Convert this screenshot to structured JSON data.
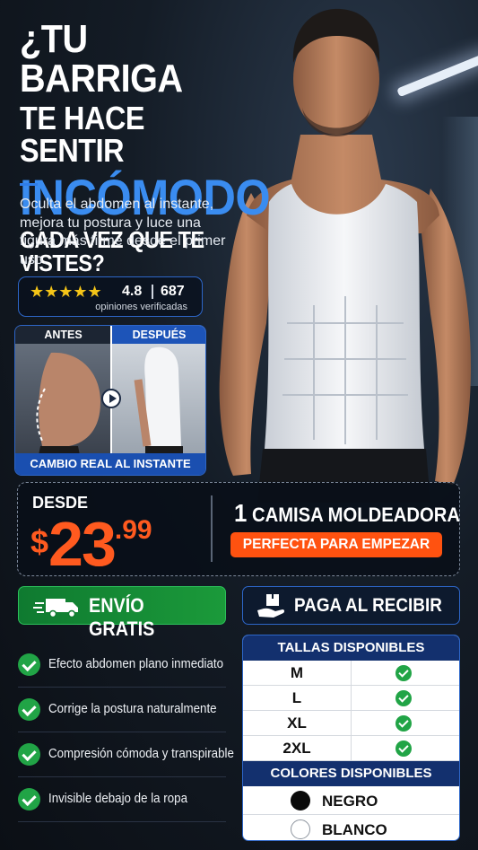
{
  "headline": {
    "line1": "¿TU BARRIGA",
    "line2": "TE HACE SENTIR",
    "line3": "INCÓMODO",
    "line4": "CADA VEZ QUE TE VISTES?"
  },
  "subtext": "Oculta el abdomen al instante, mejora tu postura y luce una figura más firme desde el primer uso.",
  "rating": {
    "stars": "★★★★★",
    "score": "4.8",
    "count": "687",
    "note": "opiniones verificadas"
  },
  "before_after": {
    "before_label": "ANTES",
    "after_label": "DESPUÉS",
    "caption": "CAMBIO REAL AL INSTANTE"
  },
  "price": {
    "from_label": "DESDE",
    "currency": "$",
    "integer": "23",
    "decimals": ".99",
    "product_qty": "1",
    "product_name": "CAMISA MOLDEADORA",
    "tag": "PERFECTA PARA EMPEZAR"
  },
  "shipping": {
    "label": "ENVÍO GRATIS",
    "icon": "delivery-truck-icon"
  },
  "cod": {
    "label": "PAGA AL RECIBIR",
    "icon": "hand-package-icon"
  },
  "benefits": [
    "Efecto abdomen plano inmediato",
    "Corrige la postura naturalmente",
    "Compresión cómoda y transpirable",
    "Invisible debajo de la ropa"
  ],
  "sizes": {
    "title": "TALLAS DISPONIBLES",
    "items": [
      "M",
      "L",
      "XL",
      "2XL"
    ]
  },
  "colors": {
    "title": "COLORES DISPONIBLES",
    "items": [
      "NEGRO",
      "BLANCO"
    ]
  },
  "palette": {
    "accent_blue": "#3a8cf0",
    "price_orange": "#ff5a1f",
    "tag_orange": "#ff5210",
    "check_green": "#21a446",
    "table_navy": "#13306e"
  }
}
